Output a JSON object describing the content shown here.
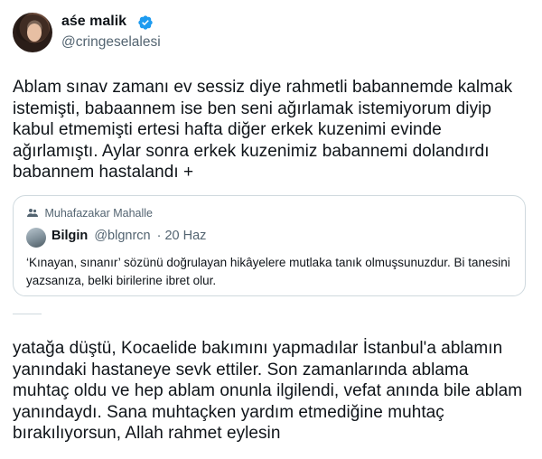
{
  "author": {
    "display_name": "aśe malik",
    "handle": "@cringeselalesi",
    "verified": true
  },
  "tweet": {
    "text_part1": "Ablam sınav zamanı ev sessiz diye rahmetli babannemde kalmak istemişti, babaannem ise ben seni ağırlamak istemiyorum diyip kabul etmemişti ertesi hafta diğer erkek kuzenimi evinde ağırlamıştı. Aylar sonra erkek kuzenimiz babannemi dolandırdı babannem hastalandı +",
    "text_part2": "yatağa düştü, Kocaelide bakımını yapmadılar İstanbul'a ablamın yanındaki hastaneye sevk ettiler. Son zamanlarında ablama muhtaç oldu ve hep ablam onunla ilgilendi, vefat anında bile ablam yanındaydı. Sana muhtaçken yardım etmediğine muhtaç bırakılıyorsun, Allah rahmet eylesin"
  },
  "quote": {
    "social_context": "Muhafazakar Mahalle",
    "author_name": "Bilgin",
    "author_handle": "@blgnrcn",
    "date": "· 20 Haz",
    "text": "‘Kınayan, sınanır’ sözünü doğrulayan hikâyelere mutlaka tanık olmuşsunuzdur. Bi tanesini yazsanıza, belki birilerine ibret olur."
  },
  "colors": {
    "text_primary": "#0f1419",
    "text_secondary": "#536471",
    "verified_blue": "#1d9bf0",
    "border": "#cfd9de"
  },
  "icons": {
    "verified": "verified-badge-icon",
    "social_context": "people-icon"
  }
}
